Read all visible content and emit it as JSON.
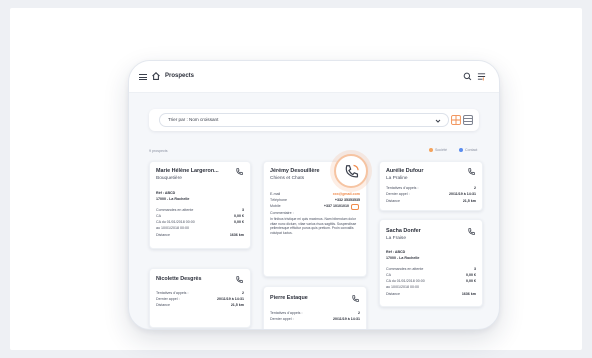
{
  "app": {
    "title": "Prospects"
  },
  "sort": {
    "label": "Trier par : Nom croissant"
  },
  "list": {
    "count": "9 prospects",
    "legend": [
      {
        "label": "Société",
        "color": "#f4a35c"
      },
      {
        "label": "Contact",
        "color": "#5b8def"
      }
    ]
  },
  "colors": {
    "accent": "#f08a4b",
    "focus_ring": "#f6c4a2"
  },
  "icons": [
    "menu-icon",
    "home-icon",
    "search-icon",
    "filter-icon",
    "chevron-down-icon",
    "grid-view-icon",
    "list-view-icon",
    "phone-icon",
    "message-icon"
  ],
  "cards": {
    "c1": {
      "name": "Marie Hélène Largeron...",
      "company": "Bouquetière",
      "ref": "Réf : ABCD",
      "city": "17000 - La Rochelle",
      "rows": [
        {
          "label": "Commandes en attente",
          "value": "3"
        },
        {
          "label": "CA",
          "value": "0,00 €"
        },
        {
          "label": "CA du 01/01/2018 00:00",
          "value": "0,00 €"
        },
        {
          "label": "au 10/01/2018 00:00",
          "value": ""
        },
        {
          "label": "Distance",
          "value": "1636 km"
        }
      ]
    },
    "c2": {
      "name": "Jérémy Desouillère",
      "company": "Chiens et Chats",
      "rows": [
        {
          "label": "E-mail",
          "value": "xxx@gmail.com"
        },
        {
          "label": "Téléphone",
          "value": "+332 35353535"
        },
        {
          "label": "Mobile",
          "value": "+337 10101010"
        }
      ],
      "comment_label": "Commentaire :",
      "comment": "In finibus tristique mi quis maximus. Nam bibendum dolor vitae nunc dictum, vitae varius risus sagittis. Suspendisse pellentesque efficitur purus quis pretium. Proin convallis volutpat luctus."
    },
    "c3": {
      "name": "Aurélie Dufour",
      "company": "La Praline",
      "rows": [
        {
          "label": "Tentatives d'appels :",
          "value": "2"
        },
        {
          "label": "Dernier appel :",
          "value": "20/11/19 à 14:31"
        },
        {
          "label": "Distance",
          "value": "21,5 km"
        }
      ]
    },
    "c4": {
      "name": "Nicolette Desgrès",
      "rows": [
        {
          "label": "Tentatives d'appels :",
          "value": "2"
        },
        {
          "label": "Dernier appel :",
          "value": "20/11/19 à 14:31"
        },
        {
          "label": "Distance",
          "value": "21,5 km"
        }
      ]
    },
    "c5": {
      "name": "Pierre Estaque",
      "rows": [
        {
          "label": "Tentatives d'appels :",
          "value": "2"
        },
        {
          "label": "Dernier appel :",
          "value": "20/11/19 à 14:31"
        }
      ]
    },
    "c6": {
      "name": "Sacha Donfer",
      "company": "La Fraise",
      "ref": "Réf : ABCD",
      "city": "17000 - La Rochelle",
      "rows": [
        {
          "label": "Commandes en attente",
          "value": "3"
        },
        {
          "label": "CA",
          "value": "0,00 €"
        },
        {
          "label": "CA du 01/01/2018 00:00",
          "value": "0,00 €"
        },
        {
          "label": "au 10/01/2018 00:00",
          "value": ""
        },
        {
          "label": "Distance",
          "value": "1636 km"
        }
      ]
    }
  }
}
